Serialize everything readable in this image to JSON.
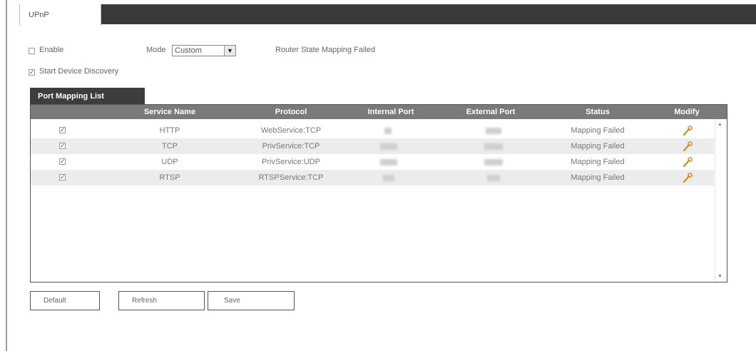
{
  "tab": {
    "label": "UPnP"
  },
  "upnp": {
    "enable_label": "Enable",
    "enable_checked": false,
    "mode_label": "Mode",
    "mode_value": "Custom",
    "status_text": "Router State Mapping Failed",
    "start_discovery_label": "Start Device Discovery",
    "start_discovery_checked": true
  },
  "list": {
    "tab_label": "Port Mapping List",
    "columns": [
      "Service Name",
      "Protocol",
      "Internal Port",
      "External Port",
      "Status",
      "Modify"
    ],
    "rows": [
      {
        "checked": true,
        "service": "HTTP",
        "protocol": "WebService:TCP",
        "status": "Mapping Failed"
      },
      {
        "checked": true,
        "service": "TCP",
        "protocol": "PrivService:TCP",
        "status": "Mapping Failed"
      },
      {
        "checked": true,
        "service": "UDP",
        "protocol": "PrivService:UDP",
        "status": "Mapping Failed"
      },
      {
        "checked": true,
        "service": "RTSP",
        "protocol": "RTSPService:TCP",
        "status": "Mapping Failed"
      }
    ]
  },
  "buttons": {
    "default": "Default",
    "refresh": "Refresh",
    "save": "Save"
  },
  "colors": {
    "header_bg": "#7a7a7a",
    "tab_bar": "#3a3a3a",
    "alt_row": "#ececec",
    "wrench": "#d98a1a"
  }
}
